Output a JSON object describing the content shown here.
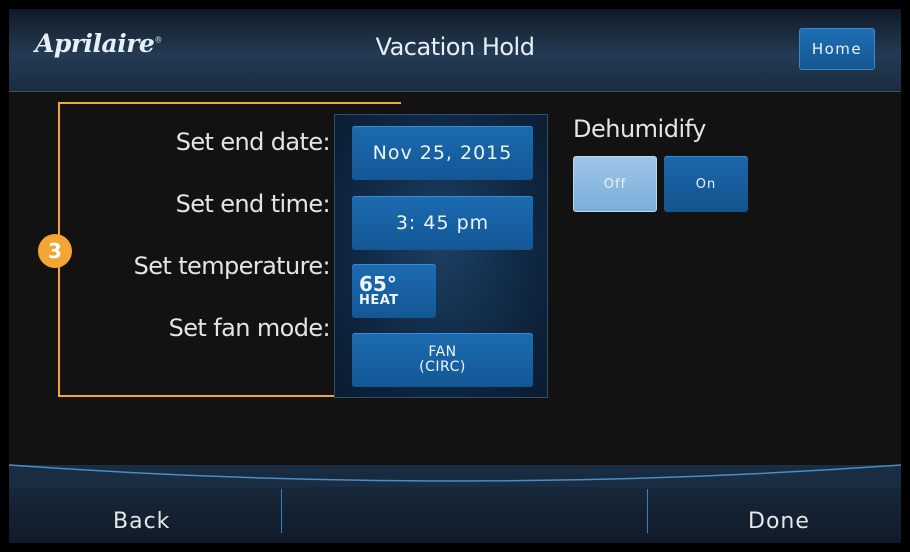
{
  "header": {
    "logo_text": "Aprilaire",
    "logo_mark": "®",
    "title": "Vacation Hold",
    "home_label": "Home"
  },
  "step_badge": "3",
  "rows": {
    "end_date_label": "Set end date:",
    "end_date_value": "Nov 25, 2015",
    "end_time_label": "Set end time:",
    "end_time_value": "3: 45 pm",
    "temperature_label": "Set temperature:",
    "temperature_value": "65°",
    "temperature_mode": "HEAT",
    "fan_mode_label": "Set fan mode:",
    "fan_mode_line1": "FAN",
    "fan_mode_line2": "(CIRC)"
  },
  "dehumidify": {
    "label": "Dehumidify",
    "off_label": "Off",
    "on_label": "On",
    "selected": "Off"
  },
  "footer": {
    "back_label": "Back",
    "done_label": "Done"
  },
  "colors": {
    "accent_orange": "#f4a533",
    "button_blue": "#1c6bb0",
    "selected_toggle": "#8ebde3"
  }
}
